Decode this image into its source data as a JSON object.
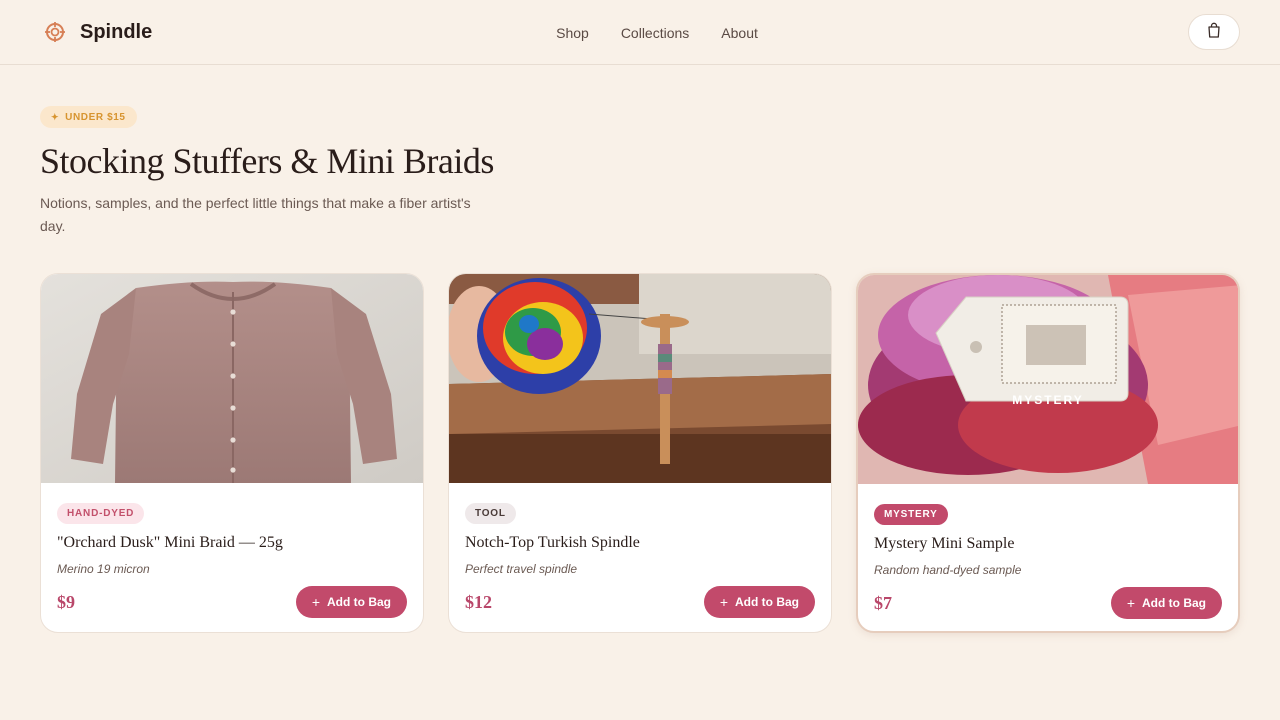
{
  "header": {
    "brand": "Spindle",
    "nav": [
      "Shop",
      "Collections",
      "About"
    ],
    "cart_icon": "shopping-bag-icon"
  },
  "hero": {
    "badge": "UNDER $15",
    "badge_icon": "sparkle-icon",
    "title": "Stocking Stuffers & Mini Braids",
    "subtitle": "Notions, samples, and the perfect little things that make a fiber artist's day."
  },
  "products": [
    {
      "tag": "HAND-DYED",
      "title": "\"Orchard Dusk\" Mini Braid — 25g",
      "note": "Merino 19 micron",
      "price": "$9",
      "button": "Add to Bag"
    },
    {
      "tag": "TOOL",
      "title": "Notch-Top Turkish Spindle",
      "note": "Perfect travel spindle",
      "price": "$12",
      "button": "Add to Bag"
    },
    {
      "tag": "MYSTERY",
      "image_label": "MYSTERY",
      "title": "Mystery Mini Sample",
      "note": "Random hand-dyed sample",
      "price": "$7",
      "button": "Add to Bag"
    }
  ],
  "colors": {
    "accent": "#c24a6b",
    "background": "#f9f1e8",
    "badge": "#d7942f"
  }
}
